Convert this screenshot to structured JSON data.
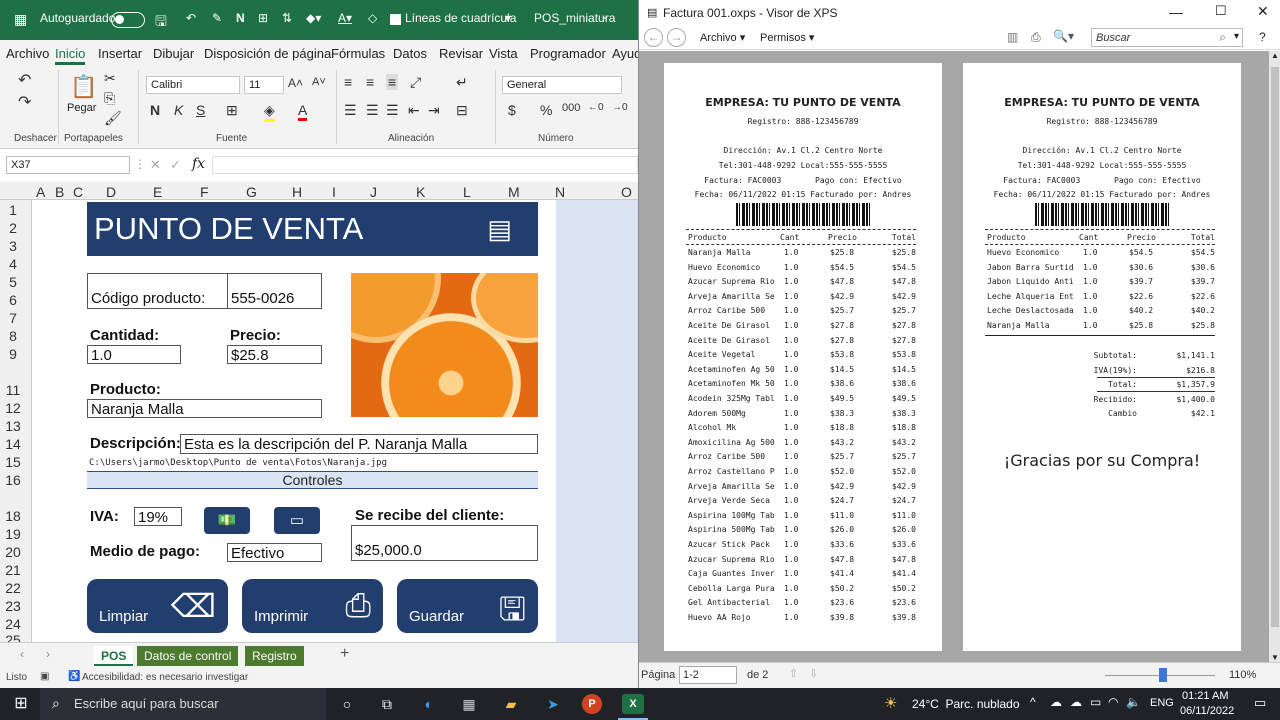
{
  "excel": {
    "title": {
      "autosave_label": "Autoguardado",
      "gridlines_label": "Líneas de cuadrícula",
      "file_name": "POS_miniatura"
    },
    "menu": [
      "Archivo",
      "Inicio",
      "Insertar",
      "Dibujar",
      "Disposición de página",
      "Fórmulas",
      "Datos",
      "Revisar",
      "Vista",
      "Programador",
      "Ayuda"
    ],
    "ribbon": {
      "undo_group": "Deshacer",
      "paste_label": "Pegar",
      "clipboard_group": "Portapapeles",
      "font_name": "Calibri",
      "font_size": "11",
      "font_group": "Fuente",
      "alignment_group": "Alineación",
      "number_format": "General",
      "number_group": "Número"
    },
    "name_box": "X37",
    "columns": [
      "A",
      "B",
      "C",
      "D",
      "E",
      "F",
      "G",
      "H",
      "I",
      "J",
      "K",
      "L",
      "M",
      "N",
      "O"
    ],
    "rows": [
      "1",
      "2",
      "3",
      "4",
      "5",
      "6",
      "7",
      "8",
      "9",
      "11",
      "12",
      "13",
      "14",
      "15",
      "16",
      "18",
      "19",
      "20",
      "21",
      "22",
      "23",
      "24",
      "25"
    ],
    "pos": {
      "banner_title": "PUNTO DE VENTA",
      "code_label": "Código producto:",
      "code_value": "555-0026",
      "qty_label": "Cantidad:",
      "qty_value": "1.0",
      "price_label": "Precio:",
      "price_value": "$25.8",
      "product_label": "Producto:",
      "product_value": "Naranja Malla",
      "desc_label": "Descripción:",
      "desc_value": "Esta es la descripción del P. Naranja Malla",
      "photo_path": "C:\\Users\\jarmo\\Desktop\\Punto de venta\\Fotos\\Naranja.jpg",
      "controls_label": "Controles",
      "iva_label": "IVA:",
      "iva_value": "19%",
      "received_label": "Se recibe del cliente:",
      "received_value": "$25,000.0",
      "payment_label": "Medio de pago:",
      "payment_value": "Efectivo",
      "btn_clear": "Limpiar",
      "btn_print": "Imprimir",
      "btn_save": "Guardar"
    },
    "sheet_tabs": [
      "POS",
      "Datos de control",
      "Registro"
    ],
    "status": {
      "ready": "Listo",
      "accessibility": "Accesibilidad: es necesario investigar"
    },
    "colors": {
      "accent": "#1e7145",
      "banner": "#223e6e"
    }
  },
  "viewer": {
    "title": "Factura 001.oxps - Visor de XPS",
    "menu": [
      "Archivo",
      "Permisos"
    ],
    "search_placeholder": "Buscar",
    "receipt": {
      "company": "EMPRESA: TU PUNTO DE VENTA",
      "registry": "Registro: 888-123456789",
      "address": "Dirección: Av.1 Cl.2 Centro Norte",
      "phones": "Tel:301-448-9292 Local:555-555-5555",
      "invoice_line": "Factura: FAC0003       Pago con: Efectivo",
      "date_line": "Fecha: 06/11/2022 01:15  Facturado por: Andres",
      "headers": [
        "Producto",
        "Cant",
        "Precio",
        "Total"
      ]
    },
    "page1_items": [
      [
        "Naranja Malla",
        "1.0",
        "$25.8",
        "$25.8"
      ],
      [
        "Huevo Economico",
        "1.0",
        "$54.5",
        "$54.5"
      ],
      [
        "Azucar Suprema Rio",
        "1.0",
        "$47.8",
        "$47.8"
      ],
      [
        "Arveja Amarilla Se",
        "1.0",
        "$42.9",
        "$42.9"
      ],
      [
        "Arroz Caribe 500",
        "1.0",
        "$25.7",
        "$25.7"
      ],
      [
        "Aceite De Girasol",
        "1.0",
        "$27.8",
        "$27.8"
      ],
      [
        "Aceite De Girasol",
        "1.0",
        "$27.8",
        "$27.8"
      ],
      [
        "Aceite Vegetal",
        "1.0",
        "$53.8",
        "$53.8"
      ],
      [
        "Acetaminofen Ag 50",
        "1.0",
        "$14.5",
        "$14.5"
      ],
      [
        "Acetaminofen Mk 50",
        "1.0",
        "$38.6",
        "$38.6"
      ],
      [
        "Acodein 325Mg Tabl",
        "1.0",
        "$49.5",
        "$49.5"
      ],
      [
        "Adorem 500Mg",
        "1.0",
        "$38.3",
        "$38.3"
      ],
      [
        "Alcohol Mk",
        "1.0",
        "$18.8",
        "$18.8"
      ],
      [
        "Amoxicilina Ag 500",
        "1.0",
        "$43.2",
        "$43.2"
      ],
      [
        "Arroz Caribe 500",
        "1.0",
        "$25.7",
        "$25.7"
      ],
      [
        "Arroz Castellano P",
        "1.0",
        "$52.0",
        "$52.0"
      ],
      [
        "Arveja Amarilla Se",
        "1.0",
        "$42.9",
        "$42.9"
      ],
      [
        "Arveja Verde Seca",
        "1.0",
        "$24.7",
        "$24.7"
      ],
      [
        "Aspirina 100Mg Tab",
        "1.0",
        "$11.0",
        "$11.0"
      ],
      [
        "Aspirina 500Mg Tab",
        "1.0",
        "$26.0",
        "$26.0"
      ],
      [
        "Azucar Stick Pack",
        "1.0",
        "$33.6",
        "$33.6"
      ],
      [
        "Azucar Suprema Rio",
        "1.0",
        "$47.8",
        "$47.8"
      ],
      [
        "Caja Guantes Inver",
        "1.0",
        "$41.4",
        "$41.4"
      ],
      [
        "Cebolla Larga Pura",
        "1.0",
        "$50.2",
        "$50.2"
      ],
      [
        "Gel Antibacterial",
        "1.0",
        "$23.6",
        "$23.6"
      ],
      [
        "Huevo AA Rojo",
        "1.0",
        "$39.8",
        "$39.8"
      ]
    ],
    "page2_items": [
      [
        "Huevo Economico",
        "1.0",
        "$54.5",
        "$54.5"
      ],
      [
        "Jabon Barra Surtid",
        "1.0",
        "$30.6",
        "$30.6"
      ],
      [
        "Jabon Liquido Anti",
        "1.0",
        "$39.7",
        "$39.7"
      ],
      [
        "Leche Alqueria Ent",
        "1.0",
        "$22.6",
        "$22.6"
      ],
      [
        "Leche Deslactosada",
        "1.0",
        "$40.2",
        "$40.2"
      ],
      [
        "Naranja Malla",
        "1.0",
        "$25.8",
        "$25.8"
      ]
    ],
    "totals": [
      [
        "Subtotal:",
        "$1,141.1"
      ],
      [
        "IVA(19%):",
        "$216.8"
      ],
      [
        "Total:",
        "$1,357.9"
      ],
      [
        "Recibido:",
        "$1,400.0"
      ],
      [
        "Cambio",
        "$42.1"
      ]
    ],
    "thanks": "¡Gracias por su Compra!",
    "status": {
      "page_label": "Página",
      "page_value": "1-2",
      "page_of": "de 2",
      "zoom": "110%"
    }
  },
  "taskbar": {
    "search_placeholder": "Escribe aquí para buscar",
    "weather": "24°C  Parc. nublado",
    "language": "ENG",
    "time": "01:21 AM",
    "date": "06/11/2022"
  }
}
